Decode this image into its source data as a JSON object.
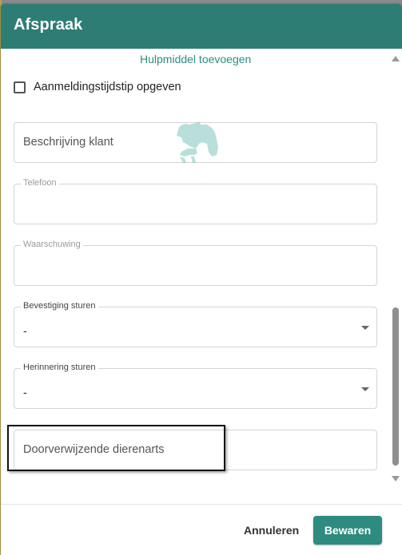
{
  "dialog": {
    "title": "Afspraak"
  },
  "form": {
    "add_aid_link": "Hulpmiddel toevoegen",
    "checkin_time_label": "Aanmeldingstijdstip opgeven",
    "client_description_placeholder": "Beschrijving klant",
    "phone_label": "Telefoon",
    "warning_label": "Waarschuwing",
    "send_confirmation": {
      "label": "Bevestiging sturen",
      "value": "-"
    },
    "send_reminder": {
      "label": "Herinnering sturen",
      "value": "-"
    },
    "referring_vet_placeholder": "Doorverwijzende dierenarts"
  },
  "footer": {
    "cancel_label": "Annuleren",
    "save_label": "Bewaren"
  },
  "colors": {
    "header": "#2e7d74",
    "accent": "#2e8b80"
  }
}
